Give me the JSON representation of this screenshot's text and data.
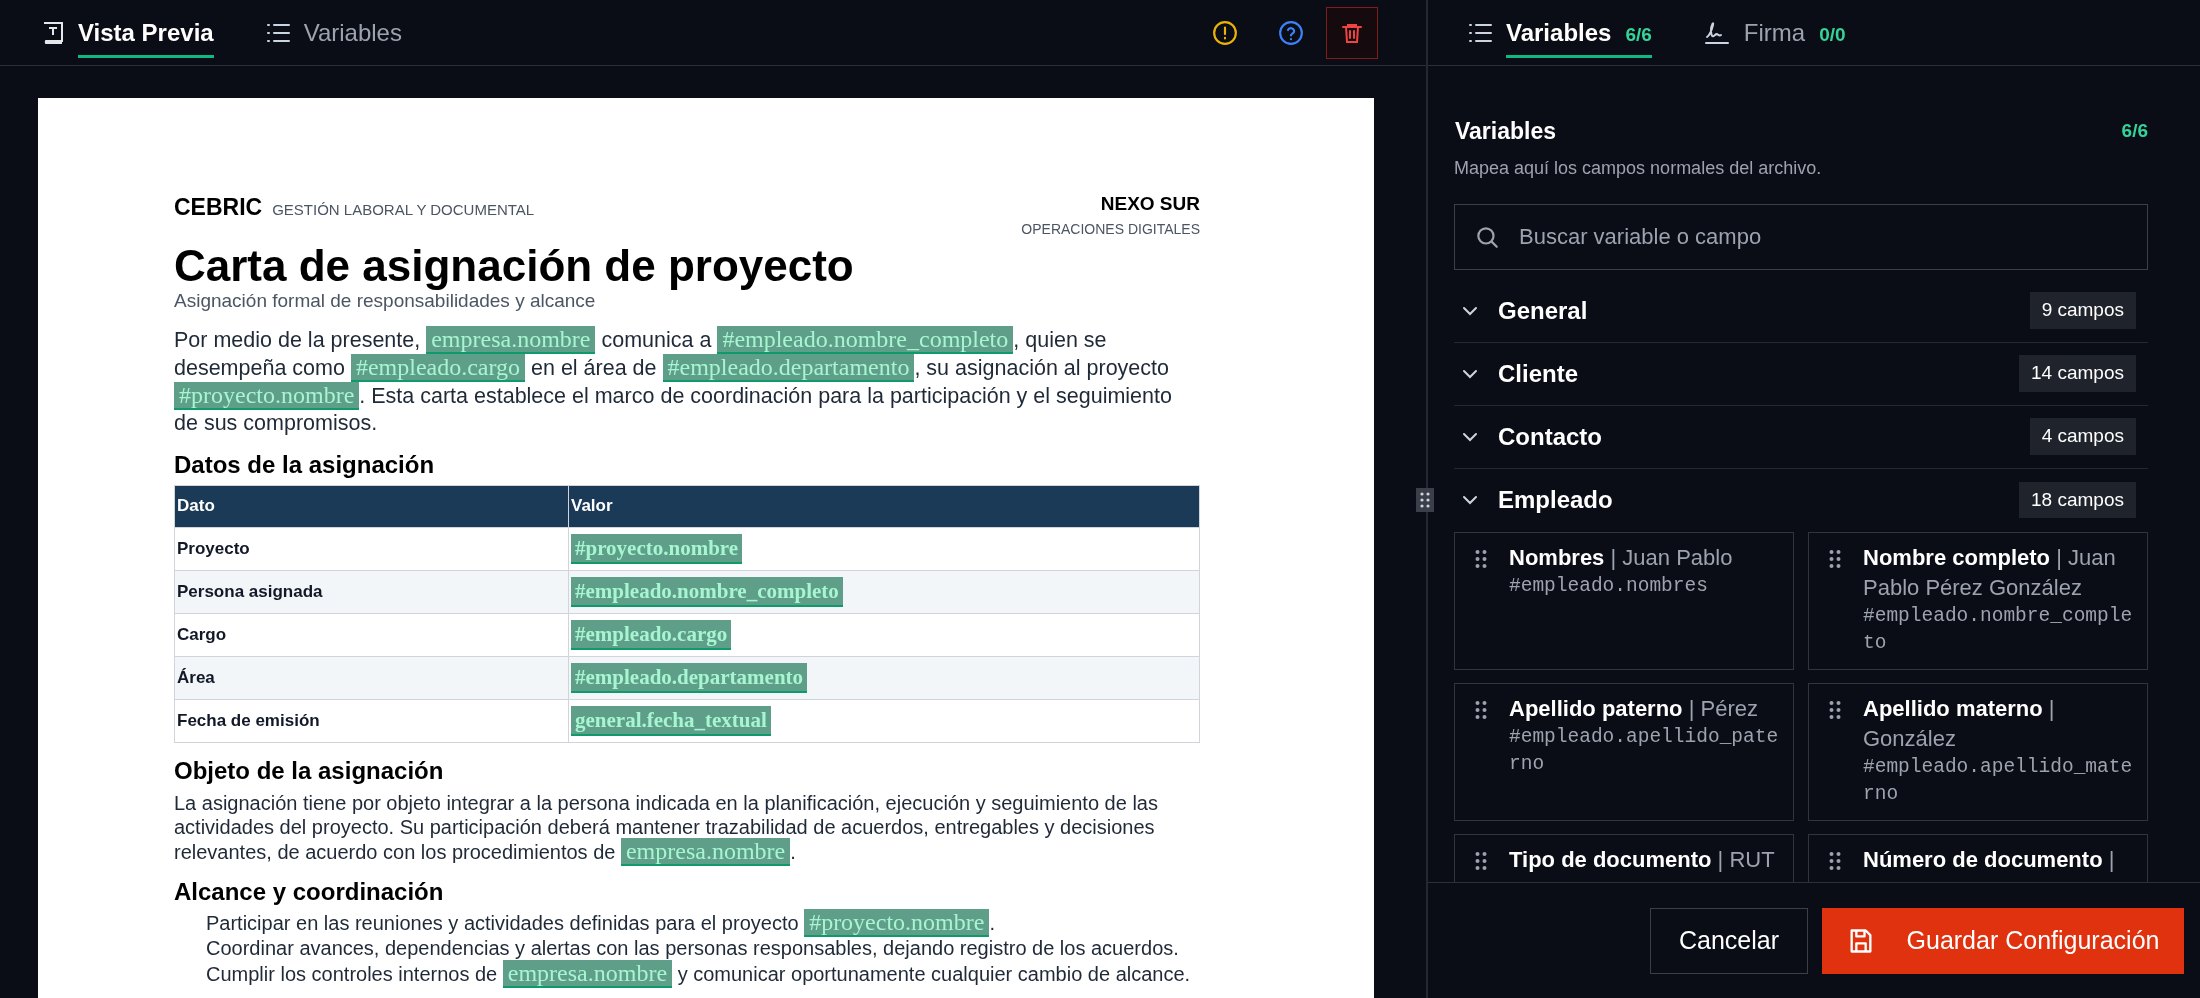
{
  "left_tabs": [
    {
      "label": "Vista Previa",
      "selected": true
    },
    {
      "label": "Variables",
      "selected": false
    }
  ],
  "document": {
    "brand": "CEBRIC",
    "brand_subtitle": "GESTIÓN LABORAL Y DOCUMENTAL",
    "company": "NEXO SUR",
    "company_subtitle": "OPERACIONES DIGITALES",
    "title": "Carta de asignación de proyecto",
    "subtitle": "Asignación formal de responsabilidades y alcance",
    "blocks": [
      {
        "kind": "paragraph",
        "segments": [
          {
            "kind": "text",
            "text": "Por medio de la presente, "
          },
          {
            "kind": "tag",
            "text": "empresa.nombre"
          },
          {
            "kind": "text",
            "text": " comunica a "
          },
          {
            "kind": "tag",
            "text": "#empleado.nombre_completo"
          },
          {
            "kind": "text",
            "text": ", quien se desempeña como "
          },
          {
            "kind": "tag",
            "text": "#empleado.cargo"
          },
          {
            "kind": "text",
            "text": " en el área de "
          },
          {
            "kind": "tag",
            "text": "#empleado.departamento"
          },
          {
            "kind": "text",
            "text": ", su asignación al proyecto "
          },
          {
            "kind": "tag",
            "text": "#proyecto.nombre"
          },
          {
            "kind": "text",
            "text": ". Esta carta establece el marco de coordinación para la participación y el seguimiento de sus compromisos."
          }
        ]
      },
      {
        "kind": "heading",
        "text": "Datos de la asignación"
      },
      {
        "kind": "table",
        "columns": [
          "Dato",
          "Valor"
        ],
        "rows": [
          {
            "label": "Proyecto",
            "value": "#proyecto.nombre"
          },
          {
            "label": "Persona asignada",
            "value": "#empleado.nombre_completo"
          },
          {
            "label": "Cargo",
            "value": "#empleado.cargo"
          },
          {
            "label": "Área",
            "value": "#empleado.departamento"
          },
          {
            "label": "Fecha de emisión",
            "value": "general.fecha_textual"
          }
        ]
      },
      {
        "kind": "heading",
        "text": "Objeto de la asignación"
      },
      {
        "kind": "paragraph",
        "segments": [
          {
            "kind": "text",
            "text": "La asignación tiene por objeto integrar a la persona indicada en la planificación, ejecución y seguimiento de las actividades del proyecto. Su participación deberá mantener trazabilidad de acuerdos, entregables y decisiones relevantes, de acuerdo con los procedimientos de "
          },
          {
            "kind": "tag",
            "text": "empresa.nombre"
          },
          {
            "kind": "text",
            "text": "."
          }
        ]
      },
      {
        "kind": "heading",
        "text": "Alcance y coordinación"
      },
      {
        "kind": "list",
        "items": [
          {
            "segments": [
              {
                "kind": "text",
                "text": "Participar en las reuniones y actividades definidas para el proyecto "
              },
              {
                "kind": "tag",
                "text": "#proyecto.nombre"
              },
              {
                "kind": "text",
                "text": "."
              }
            ]
          },
          {
            "segments": [
              {
                "kind": "text",
                "text": "Coordinar avances, dependencias y alertas con las personas responsables, dejando registro de los acuerdos."
              }
            ]
          },
          {
            "segments": [
              {
                "kind": "text",
                "text": "Cumplir los controles internos de "
              },
              {
                "kind": "tag",
                "text": "empresa.nombre"
              },
              {
                "kind": "text",
                "text": " y comunicar oportunamente cualquier cambio de alcance."
              }
            ]
          }
        ]
      }
    ]
  },
  "right_tabs": [
    {
      "label": "Variables",
      "count": "6/6",
      "selected": true
    },
    {
      "label": "Firma",
      "count": "0/0",
      "selected": false
    }
  ],
  "panel": {
    "title": "Variables",
    "count": "6/6",
    "description": "Mapea aquí los campos normales del archivo.",
    "search": {
      "placeholder": "Buscar variable o campo"
    },
    "groups": [
      {
        "name": "General",
        "count": "9 campos"
      },
      {
        "name": "Cliente",
        "count": "14 campos"
      },
      {
        "name": "Contacto",
        "count": "4 campos"
      },
      {
        "name": "Empleado",
        "count": "18 campos",
        "fields": [
          {
            "name": "Nombres",
            "value": "| Juan Pablo",
            "key": "#empleado.nombres"
          },
          {
            "name": "Nombre completo",
            "value": "| Juan Pablo Pérez González",
            "key": "#empleado.nombre_completo"
          },
          {
            "name": "Apellido paterno",
            "value": "| Pérez",
            "key": "#empleado.apellido_paterno"
          },
          {
            "name": "Apellido materno",
            "value": "| González",
            "key": "#empleado.apellido_materno"
          },
          {
            "name": "Tipo de documento",
            "value": "| RUT"
          },
          {
            "name": "Número de documento",
            "value": "|"
          }
        ]
      }
    ]
  },
  "footer": {
    "cancel": "Cancelar",
    "save": "Guardar Configuración"
  }
}
